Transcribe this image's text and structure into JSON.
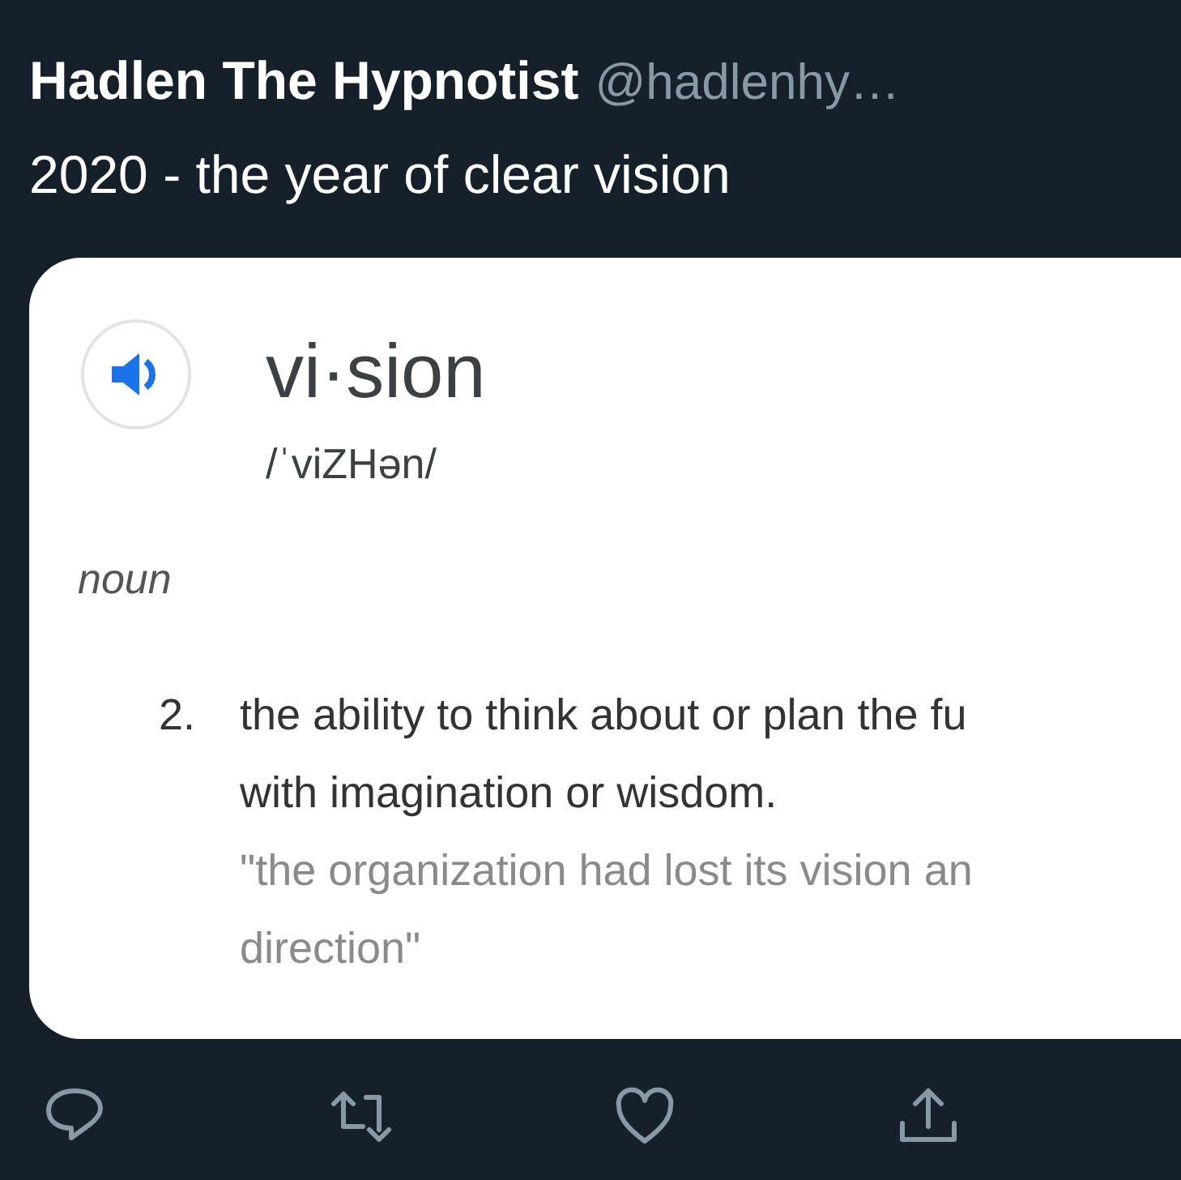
{
  "tweet": {
    "author": "Hadlen The Hypnotist",
    "handle": "@hadlenhy…",
    "text": "2020 - the year of clear vision"
  },
  "definition_card": {
    "word": "vi·sion",
    "pronunciation": "/ˈviZHən/",
    "part_of_speech": "noun",
    "sense": {
      "number": "2.",
      "lines": [
        "the ability to think about or plan the fu",
        "with imagination or wisdom."
      ],
      "example_lines": [
        "\"the organization had lost its vision an",
        "direction\""
      ]
    }
  },
  "actions": [
    {
      "kind": "reply"
    },
    {
      "kind": "retweet"
    },
    {
      "kind": "like"
    },
    {
      "kind": "share"
    }
  ]
}
